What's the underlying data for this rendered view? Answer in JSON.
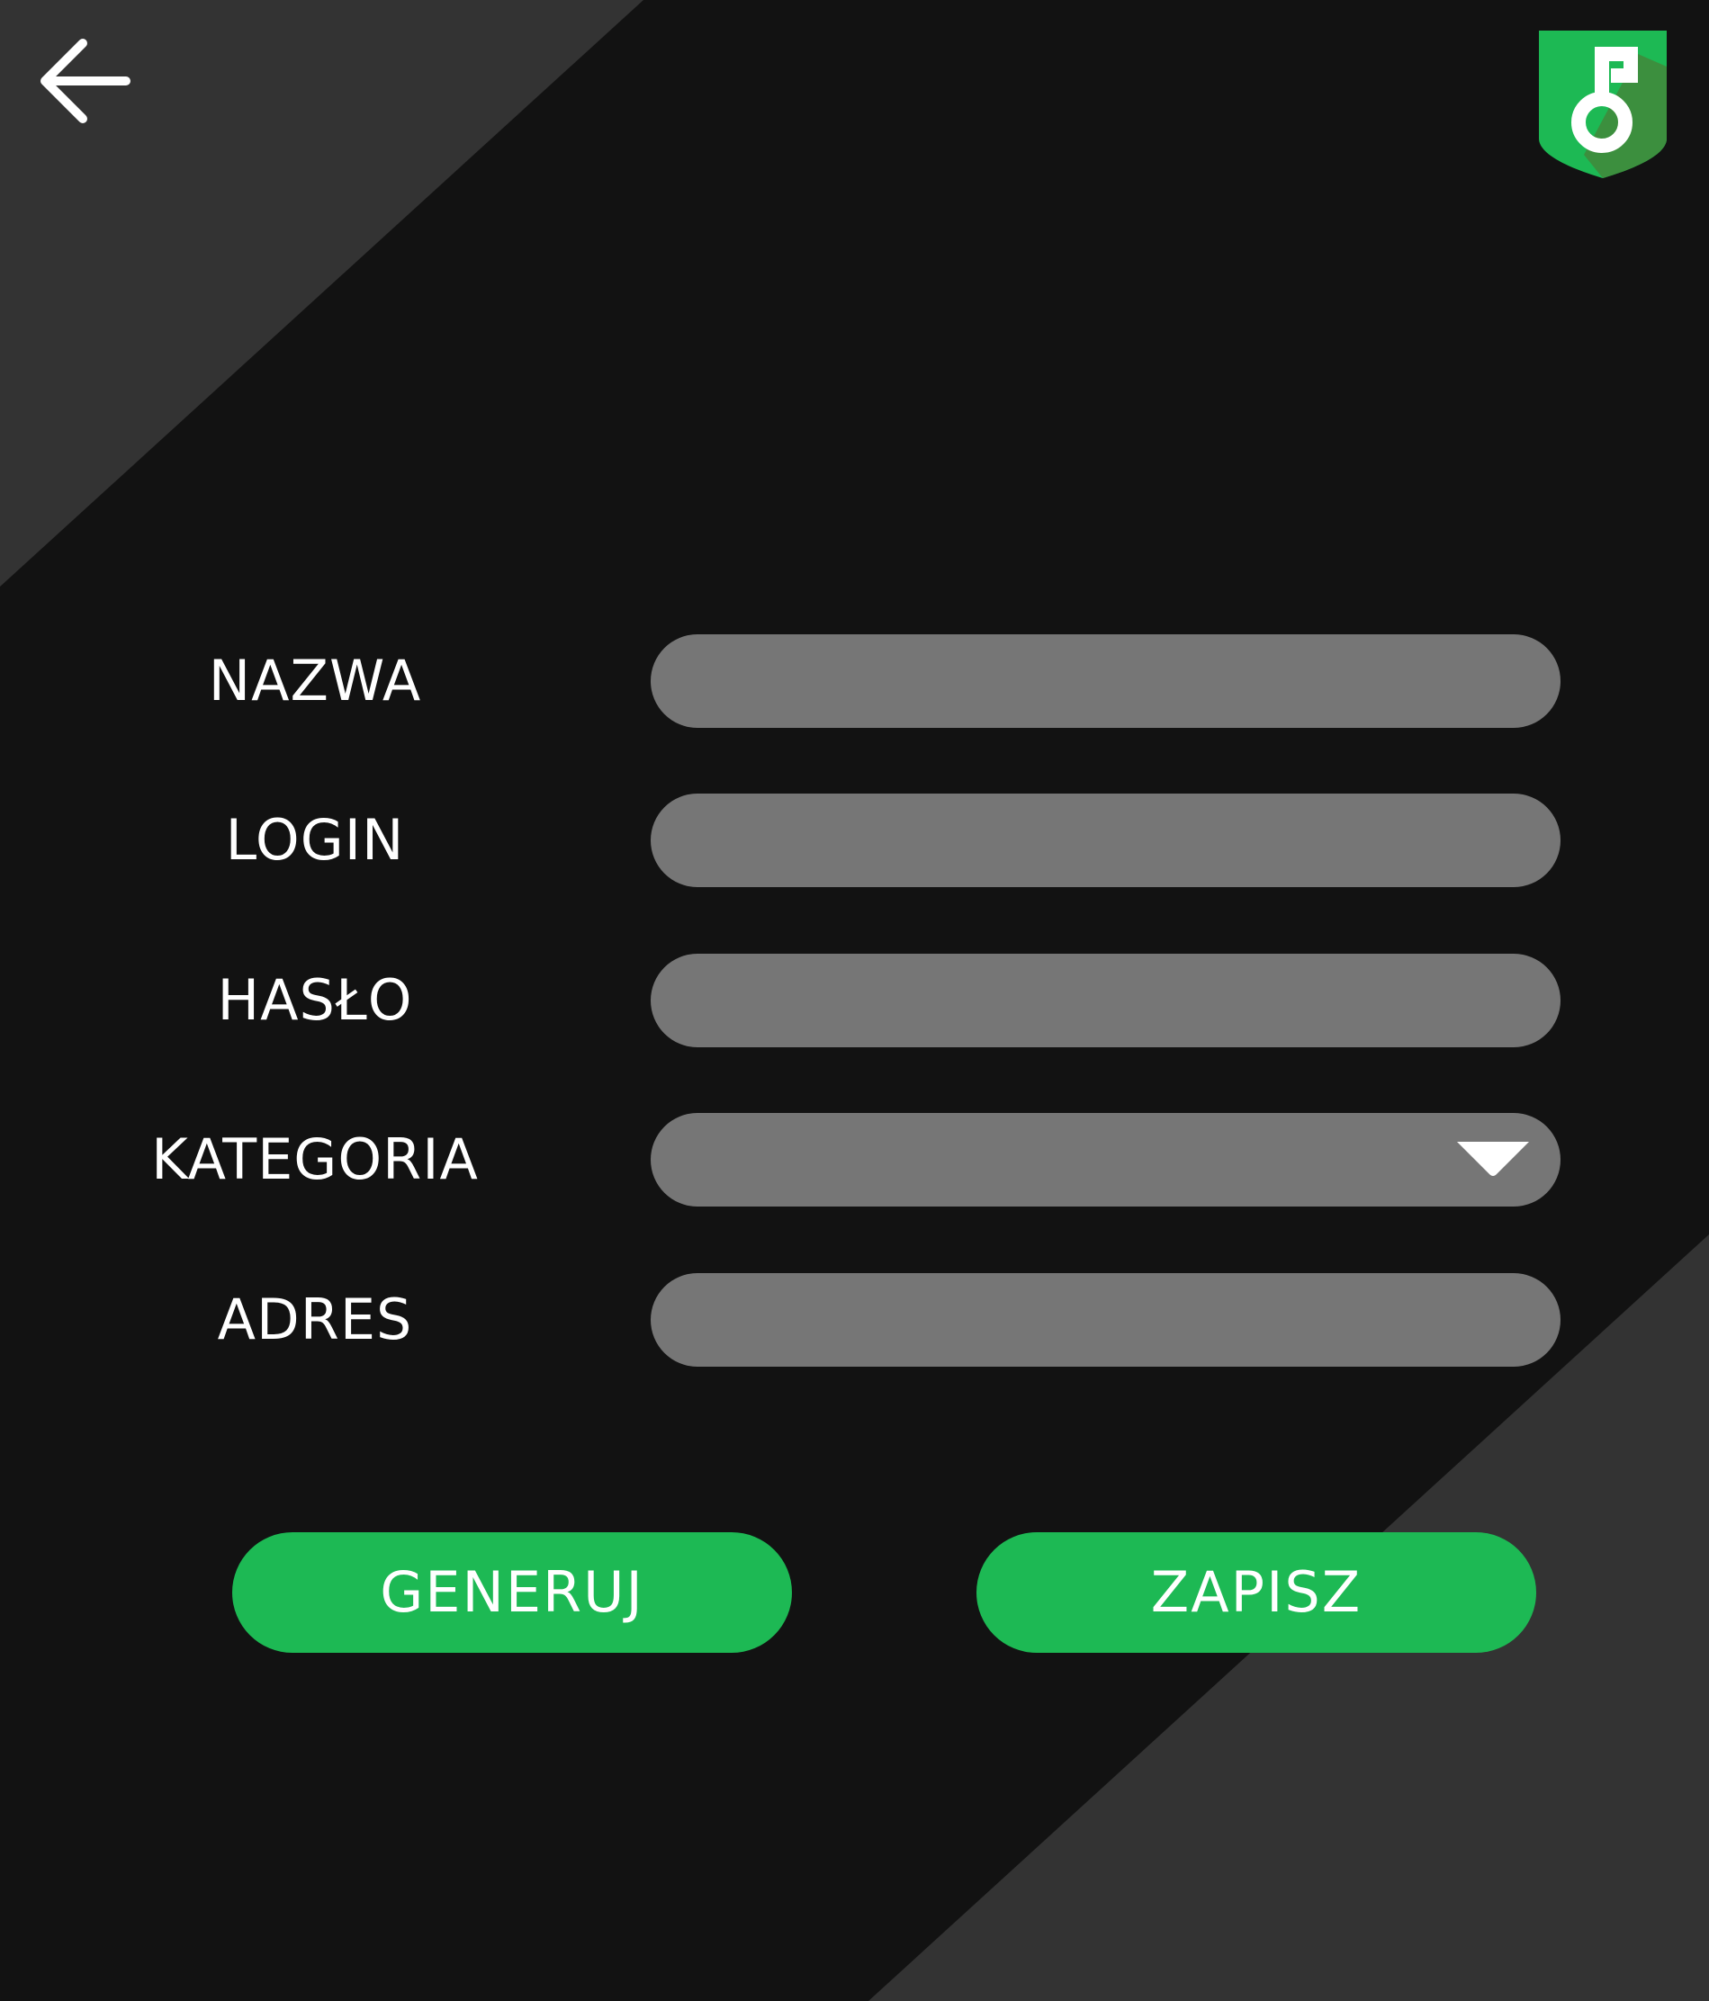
{
  "colors": {
    "background": "#121212",
    "diagonal_panel": "#333333",
    "input_fill": "#767676",
    "accent": "#1db954",
    "text": "#ffffff"
  },
  "header": {
    "back_icon": "arrow-left-icon",
    "logo_icon": "shield-key-icon"
  },
  "form": {
    "name": {
      "label": "NAZWA",
      "value": "",
      "placeholder": ""
    },
    "login": {
      "label": "LOGIN",
      "value": "",
      "placeholder": ""
    },
    "password": {
      "label": "HASŁO",
      "value": "",
      "placeholder": ""
    },
    "category": {
      "label": "KATEGORIA",
      "selected": "",
      "icon": "triangle-down-icon"
    },
    "address": {
      "label": "ADRES",
      "value": "",
      "placeholder": ""
    }
  },
  "actions": {
    "generate_label": "GENERUJ",
    "save_label": "ZAPISZ"
  }
}
